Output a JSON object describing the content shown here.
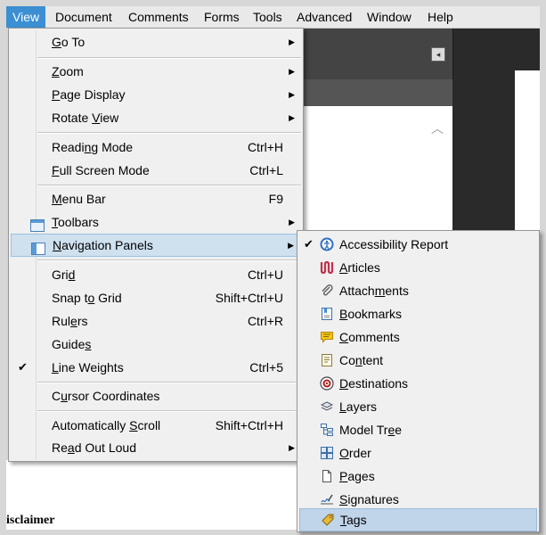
{
  "menubar": {
    "items": [
      {
        "label": "View"
      },
      {
        "label": "Document"
      },
      {
        "label": "Comments"
      },
      {
        "label": "Forms"
      },
      {
        "label": "Tools"
      },
      {
        "label": "Advanced"
      },
      {
        "label": "Window"
      },
      {
        "label": "Help"
      }
    ]
  },
  "document": {
    "disclaimer_text": "isclaimer"
  },
  "view_menu": {
    "items": [
      {
        "pre": "",
        "ul": "G",
        "post": "o To",
        "shortcut": "",
        "submenu": true
      },
      {
        "pre": "",
        "ul": "Z",
        "post": "oom",
        "shortcut": "",
        "submenu": true
      },
      {
        "pre": "",
        "ul": "P",
        "post": "age Display",
        "shortcut": "",
        "submenu": true
      },
      {
        "pre": "Rotate ",
        "ul": "V",
        "post": "iew",
        "shortcut": "",
        "submenu": true
      },
      {
        "pre": "Readi",
        "ul": "n",
        "post": "g Mode",
        "shortcut": "Ctrl+H"
      },
      {
        "pre": "",
        "ul": "F",
        "post": "ull Screen Mode",
        "shortcut": "Ctrl+L"
      },
      {
        "pre": "",
        "ul": "M",
        "post": "enu Bar",
        "shortcut": "F9"
      },
      {
        "pre": "",
        "ul": "T",
        "post": "oolbars",
        "shortcut": "",
        "submenu": true
      },
      {
        "pre": "",
        "ul": "N",
        "post": "avigation Panels",
        "shortcut": "",
        "submenu": true,
        "highlighted": true
      },
      {
        "pre": "Gri",
        "ul": "d",
        "post": "",
        "shortcut": "Ctrl+U"
      },
      {
        "pre": "Snap t",
        "ul": "o",
        "post": " Grid",
        "shortcut": "Shift+Ctrl+U"
      },
      {
        "pre": "Rul",
        "ul": "e",
        "post": "rs",
        "shortcut": "Ctrl+R"
      },
      {
        "pre": "Guide",
        "ul": "s",
        "post": "",
        "shortcut": ""
      },
      {
        "pre": "",
        "ul": "L",
        "post": "ine Weights",
        "shortcut": "Ctrl+5",
        "checked": true
      },
      {
        "pre": "C",
        "ul": "u",
        "post": "rsor Coordinates",
        "shortcut": ""
      },
      {
        "pre": "Automatically ",
        "ul": "S",
        "post": "croll",
        "shortcut": "Shift+Ctrl+H"
      },
      {
        "pre": "Re",
        "ul": "a",
        "post": "d Out Loud",
        "shortcut": "",
        "submenu": true
      }
    ],
    "check_glyph": "✔",
    "arrow_glyph": "▶"
  },
  "nav_submenu": {
    "items": [
      {
        "pre": "Accessibility Report",
        "ul": "",
        "post": "",
        "icon": "accessibility-icon",
        "checked": true
      },
      {
        "pre": "",
        "ul": "A",
        "post": "rticles",
        "icon": "articles-icon"
      },
      {
        "pre": "Attach",
        "ul": "m",
        "post": "ents",
        "icon": "paperclip-icon"
      },
      {
        "pre": "",
        "ul": "B",
        "post": "ookmarks",
        "icon": "bookmark-icon"
      },
      {
        "pre": "",
        "ul": "C",
        "post": "omments",
        "icon": "comment-icon"
      },
      {
        "pre": "Co",
        "ul": "n",
        "post": "tent",
        "icon": "content-icon"
      },
      {
        "pre": "",
        "ul": "D",
        "post": "estinations",
        "icon": "destinations-icon"
      },
      {
        "pre": "",
        "ul": "L",
        "post": "ayers",
        "icon": "layers-icon"
      },
      {
        "pre": "Model Tr",
        "ul": "e",
        "post": "e",
        "icon": "model-tree-icon"
      },
      {
        "pre": "",
        "ul": "O",
        "post": "rder",
        "icon": "order-icon"
      },
      {
        "pre": "",
        "ul": "P",
        "post": "ages",
        "icon": "pages-icon"
      },
      {
        "pre": "",
        "ul": "S",
        "post": "ignatures",
        "icon": "signature-icon"
      },
      {
        "pre": "",
        "ul": "T",
        "post": "ags",
        "icon": "tag-icon",
        "highlighted": true
      }
    ],
    "check_glyph": "✔"
  },
  "colors": {
    "menubar_active": "#3b8fd2",
    "menu_bg": "#f0f0f0",
    "highlight": "#cfe0ef"
  }
}
